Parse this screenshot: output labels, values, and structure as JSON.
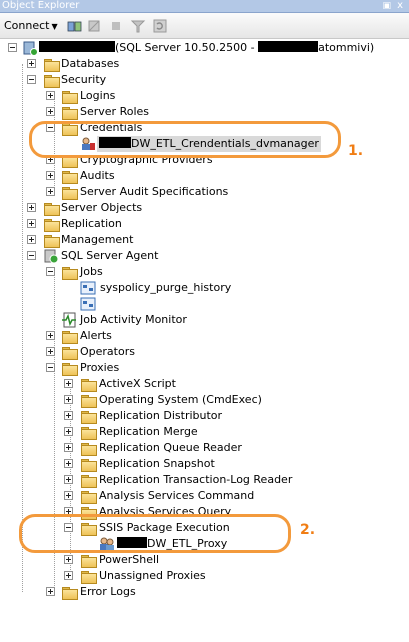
{
  "window": {
    "title": "Object Explorer",
    "pin_icon": "pin-icon",
    "close_glyph": "x"
  },
  "toolbar": {
    "connect_label": "Connect",
    "icons": [
      "connect-db-icon",
      "disconnect-icon",
      "stop-icon",
      "filter-icon",
      "refresh-icon"
    ]
  },
  "tree": {
    "server_label": "(SQL Server 10.50.2500 - ",
    "server_suffix": "atommivi)",
    "databases": "Databases",
    "security": "Security",
    "logins": "Logins",
    "server_roles": "Server Roles",
    "credentials": "Credentials",
    "credential_item": "DW_ETL_Crendentials_dvmanager",
    "cryptographic_providers": "Cryptographic Providers",
    "audits": "Audits",
    "server_audit_specifications": "Server Audit Specifications",
    "server_objects": "Server Objects",
    "replication": "Replication",
    "management": "Management",
    "sql_server_agent": "SQL Server Agent",
    "jobs": "Jobs",
    "job_1": "syspolicy_purge_history",
    "job_activity_monitor": "Job Activity Monitor",
    "alerts": "Alerts",
    "operators": "Operators",
    "proxies": "Proxies",
    "proxy_activex": "ActiveX Script",
    "proxy_os": "Operating System (CmdExec)",
    "proxy_repl_dist": "Replication Distributor",
    "proxy_repl_merge": "Replication Merge",
    "proxy_repl_queue": "Replication Queue Reader",
    "proxy_repl_snapshot": "Replication Snapshot",
    "proxy_repl_txlog": "Replication Transaction-Log Reader",
    "proxy_as_command": "Analysis Services Command",
    "proxy_as_query": "Analysis Services Query",
    "proxy_ssis": "SSIS Package Execution",
    "ssis_item": "DW_ETL_Proxy",
    "proxy_powershell": "PowerShell",
    "unassigned_proxies": "Unassigned Proxies",
    "error_logs": "Error Logs"
  },
  "annotations": {
    "one": "1.",
    "two": "2."
  },
  "colors": {
    "annotation": "#f39a3c",
    "title_bar": "#b3c8e6"
  }
}
